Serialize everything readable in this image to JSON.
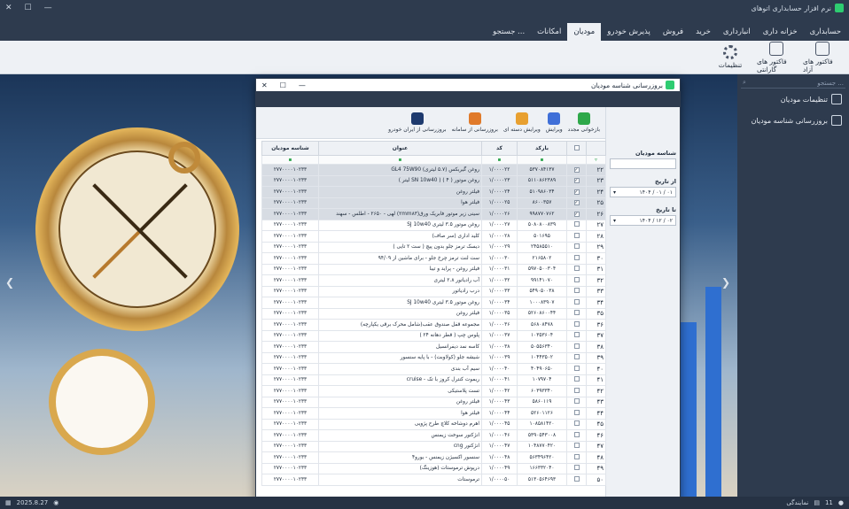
{
  "app": {
    "title": "نرم افزار حسابداری اتوهای",
    "window_controls": [
      "—",
      "☐",
      "✕"
    ]
  },
  "menu": [
    {
      "label": "حسابداری",
      "active": false
    },
    {
      "label": "خزانه داری",
      "active": false
    },
    {
      "label": "انبارداری",
      "active": false
    },
    {
      "label": "خرید",
      "active": false
    },
    {
      "label": "فروش",
      "active": false
    },
    {
      "label": "پذیرش خودرو",
      "active": false
    },
    {
      "label": "مودیان",
      "active": true
    },
    {
      "label": "امکانات",
      "active": false
    },
    {
      "label": "جستجو ...",
      "active": false
    }
  ],
  "ribbon": [
    {
      "label": "فاکتور های آزاد",
      "icon": "invoice-icon"
    },
    {
      "label": "فاکتور های گارانتی",
      "icon": "warranty-invoice-icon"
    },
    {
      "label": "تنظیمات",
      "icon": "gear-icon"
    }
  ],
  "sidepanel": {
    "search_placeholder": "جستجو ...",
    "items": [
      {
        "label": "تنظیمات مودیان",
        "icon": "settings-icon"
      },
      {
        "label": "بروزرسانی شناسه مودیان",
        "icon": "update-id-icon"
      }
    ]
  },
  "statusbar": {
    "date": "2025.8.27",
    "right_count": "11",
    "right_label": "نمایندگی"
  },
  "dialog": {
    "title": "بروزرسانی شناسه مودیان",
    "toolbar": [
      {
        "label": "بازخوانی مجدد",
        "icon": "refresh-icon",
        "color": "#2ea84a"
      },
      {
        "label": "ویرایش",
        "icon": "pencil-icon",
        "color": "#3f6fd8"
      },
      {
        "label": "ویرایش دسته ای",
        "icon": "batch-edit-icon",
        "color": "#e8a030"
      },
      {
        "label": "بروزرسانی از سامانه",
        "icon": "cloud-update-icon",
        "color": "#e07a2a"
      },
      {
        "label": "بروزرسانی از ایران خودرو",
        "icon": "ikco-logo-icon",
        "color": "#1e3a6e"
      }
    ],
    "filters": {
      "id_label": "شناسه مودیان",
      "id_value": "",
      "from_label": "از تاریخ",
      "from_value": "۱۴۰۴ / ۰۱ / ۰۱",
      "to_label": "تا تاریخ",
      "to_value": "۱۴۰۴ / ۱۲ / ۰۲"
    },
    "columns": {
      "check": "",
      "barcode": "بارکد",
      "code": "کد",
      "title": "عنوان",
      "taxid": "شناسه مودیان"
    },
    "rows": [
      {
        "num": "۲۲",
        "checked": true,
        "selected": true,
        "barcode": "۵۳۷۰۸۴۱۳۷",
        "code": "۱/۰۰۰۰۲۲",
        "title": "روغن گیربکس (۵.۷ لیتری) GL4 75W90",
        "taxid": "۲۷۷۰۰۰۰۱۰۲۳۳"
      },
      {
        "num": "۲۳",
        "checked": true,
        "selected": true,
        "barcode": "۵۱۱۰۸۶۲۳۸۹",
        "code": "۱/۰۰۰۰۲۳",
        "title": "روغن موتور ( ۴ ) ( SN 10w40 لیتر )",
        "taxid": "۲۷۷۰۰۰۰۱۰۲۳۳"
      },
      {
        "num": "۲۴",
        "checked": true,
        "selected": true,
        "barcode": "۵۱۰۹۸۶۰۳۴",
        "code": "۱/۰۰۰۰۲۴",
        "title": "فیلتر روغن",
        "taxid": "۲۷۷۰۰۰۰۱۰۲۳۳"
      },
      {
        "num": "۲۵",
        "checked": true,
        "selected": true,
        "barcode": "۸۶۰۰۳۵۷",
        "code": "۱/۰۰۰۰۲۵",
        "title": "فیلتر هوا",
        "taxid": "۲۷۷۰۰۰۰۱۰۲۳۳"
      },
      {
        "num": "۲۶",
        "checked": true,
        "selected": true,
        "barcode": "۹۹۸۷۷۰۷۶۲",
        "code": "۱/۰۰۰۰۲۶",
        "title": "سینی زیر موتور فابریک ورق(۲mm۸۳) لهی - ۲۶۵۰ - اطلس - سهند",
        "taxid": "۲۷۷۰۰۰۰۱۰۲۳۳"
      },
      {
        "num": "۲۷",
        "checked": false,
        "selected": false,
        "barcode": "۵۰۸۰۸۰۰۸۳۹",
        "code": "۱/۰۰۰۰۲۷",
        "title": "روغن موتور ۳.۵ لیتری SJ 10w40",
        "taxid": "۲۷۷۰۰۰۰۱۰۲۳۳"
      },
      {
        "num": "۲۸",
        "checked": false,
        "selected": false,
        "barcode": "۵۰۱۶۹۵",
        "code": "۱/۰۰۰۰۲۸",
        "title": "کلید اداری (سر صاف)",
        "taxid": "۲۷۷۰۰۰۰۱۰۲۳۳"
      },
      {
        "num": "۲۹",
        "checked": false,
        "selected": false,
        "barcode": "۲۴۵۸۵۵۱۰",
        "code": "۱/۰۰۰۰۲۹",
        "title": "دیسک ترمز جلو بدون پیچ ( ست ۲ تایی )",
        "taxid": "۲۷۷۰۰۰۰۱۰۲۳۳"
      },
      {
        "num": "۳۰",
        "checked": false,
        "selected": false,
        "barcode": "۲۱۶۵۸۰۲",
        "code": "۱/۰۰۰۰۳۰",
        "title": "ست لنت ترمز چرخ جلو - برای ماشین از ۹۴/۰۹",
        "taxid": "۲۷۷۰۰۰۰۱۰۲۳۳"
      },
      {
        "num": "۳۱",
        "checked": false,
        "selected": false,
        "barcode": "۵۹۷۰۵۰۰۳۰۴",
        "code": "۱/۰۰۰۰۳۱",
        "title": "فیلتر روغن - پراید و تیبا",
        "taxid": "۲۷۷۰۰۰۰۱۰۲۳۳"
      },
      {
        "num": "۳۲",
        "checked": false,
        "selected": false,
        "barcode": "۹۹۱۴۱۰۷۰",
        "code": "۱/۰۰۰۰۳۲",
        "title": "آب رادیاتور ۲.۸ لیتری",
        "taxid": "۲۷۷۰۰۰۰۱۰۲۳۳"
      },
      {
        "num": "۳۳",
        "checked": false,
        "selected": false,
        "barcode": "۵۴۹۰۵۰۰۳۸",
        "code": "۱/۰۰۰۰۳۳",
        "title": "درب رادیاتور",
        "taxid": "۲۷۷۰۰۰۰۱۰۲۳۳"
      },
      {
        "num": "۳۴",
        "checked": false,
        "selected": false,
        "barcode": "۱۰۰۰۸۳۹۰۷",
        "code": "۱/۰۰۰۰۳۴",
        "title": "روغن موتور ۳.۵ لیتری SJ 10w40",
        "taxid": "۲۷۷۰۰۰۰۱۰۲۳۳"
      },
      {
        "num": "۳۵",
        "checked": false,
        "selected": false,
        "barcode": "۵۲۶۰۸۶۰۰۴۴",
        "code": "۱/۰۰۰۰۳۵",
        "title": "فیلتر روغن",
        "taxid": "۲۷۷۰۰۰۰۱۰۲۳۳"
      },
      {
        "num": "۳۶",
        "checked": false,
        "selected": false,
        "barcode": "۵۶۸۰۸۴۷۸",
        "code": "۱/۰۰۰۰۳۶",
        "title": "مجموعه قفل صندوق عقب(شامل محرک برقی یکپارچه)",
        "taxid": "۲۷۷۰۰۰۰۱۰۲۳۳"
      },
      {
        "num": "۳۷",
        "checked": false,
        "selected": false,
        "barcode": "۱۰۳۵۳۶۰۴",
        "code": "۱/۰۰۰۰۳۷",
        "title": "پلوس چپ ( قطر دهانه ۲۴ )",
        "taxid": "۲۷۷۰۰۰۰۱۰۲۳۳"
      },
      {
        "num": "۳۸",
        "checked": false,
        "selected": false,
        "barcode": "۵۰۵۵۶۳۴۰",
        "code": "۱/۰۰۰۰۳۸",
        "title": "کاسه نمد دیفرانسیل",
        "taxid": "۲۷۷۰۰۰۰۱۰۲۳۳"
      },
      {
        "num": "۳۹",
        "checked": false,
        "selected": false,
        "barcode": "۱۰۴۴۳۵۰۲",
        "code": "۱/۰۰۰۰۳۹",
        "title": "شیشه جلو (کولاوبت) - با پایه سنسور",
        "taxid": "۲۷۷۰۰۰۰۱۰۲۳۳"
      },
      {
        "num": "۴۰",
        "checked": false,
        "selected": false,
        "barcode": "۴۰۴۹۰۶۵۰",
        "code": "۱/۰۰۰۰۴۰",
        "title": "سیم آب بندی",
        "taxid": "۲۷۷۰۰۰۰۱۰۲۳۳"
      },
      {
        "num": "۴۱",
        "checked": false,
        "selected": false,
        "barcode": "۱۰۷۹۷۰۴",
        "code": "۱/۰۰۰۰۴۱",
        "title": "ریموت کنترل کروز با تک - cruise",
        "taxid": "۲۷۷۰۰۰۰۱۰۲۳۳"
      },
      {
        "num": "۴۲",
        "checked": false,
        "selected": false,
        "barcode": "۶۰۳۹۳۳۴۰",
        "code": "۱/۰۰۰۰۴۲",
        "title": "تست پلاستیکی",
        "taxid": "۲۷۷۰۰۰۰۱۰۲۳۳"
      },
      {
        "num": "۴۳",
        "checked": false,
        "selected": false,
        "barcode": "۵۸۶۰۱۱۹",
        "code": "۱/۰۰۰۰۴۳",
        "title": "فیلتر روغن",
        "taxid": "۲۷۷۰۰۰۰۱۰۲۳۳"
      },
      {
        "num": "۴۴",
        "checked": false,
        "selected": false,
        "barcode": "۵۲۶۰۱۱۲۶",
        "code": "۱/۰۰۰۰۴۴",
        "title": "فیلتر هوا",
        "taxid": "۲۷۷۰۰۰۰۱۰۲۳۳"
      },
      {
        "num": "۴۵",
        "checked": false,
        "selected": false,
        "barcode": "۱۰۸۵۸۱۴۲۰",
        "code": "۱/۰۰۰۰۴۵",
        "title": "اهرم دوشاخه کلاچ طرح پژویی",
        "taxid": "۲۷۷۰۰۰۰۱۰۲۳۳"
      },
      {
        "num": "۴۶",
        "checked": false,
        "selected": false,
        "barcode": "۵۳۹۰۵۴۳۰۰۸",
        "code": "۱/۰۰۰۰۴۶",
        "title": "انژکتور سوخت زیمنس",
        "taxid": "۲۷۷۰۰۰۰۱۰۲۳۳"
      },
      {
        "num": "۴۷",
        "checked": false,
        "selected": false,
        "barcode": "۱۰۴۸۷۷۰۴۲۰",
        "code": "۱/۰۰۰۰۴۷",
        "title": "انژکتور cng",
        "taxid": "۲۷۷۰۰۰۰۱۰۲۳۳"
      },
      {
        "num": "۴۸",
        "checked": false,
        "selected": false,
        "barcode": "۵۶۳۴۹۶۴۲۰",
        "code": "۱/۰۰۰۰۴۸",
        "title": "سنسور اکسیژن زیمنس - یورو۴",
        "taxid": "۲۷۷۰۰۰۰۱۰۲۳۳"
      },
      {
        "num": "۴۹",
        "checked": false,
        "selected": false,
        "barcode": "۱۶۶۳۳۲۰۴۰",
        "code": "۱/۰۰۰۰۴۹",
        "title": "درپوش ترموستات (هوزینگ)",
        "taxid": "۲۷۷۰۰۰۰۱۰۲۳۳"
      },
      {
        "num": "۵۰",
        "checked": false,
        "selected": false,
        "barcode": "۵۱۳۰۵۶۴۶۹۳",
        "code": "۱/۰۰۰۰۵۰",
        "title": "ترموستات",
        "taxid": "۲۷۷۰۰۰۰۱۰۲۳۳"
      }
    ]
  }
}
